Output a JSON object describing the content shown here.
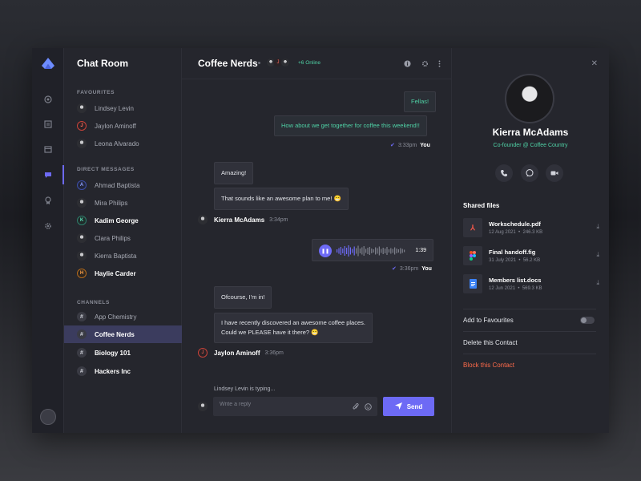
{
  "sidebar": {
    "title": "Chat Room",
    "sections": {
      "favourites": "FAVOURITES",
      "direct": "DIRECT MESSAGES",
      "channels": "CHANNELS"
    },
    "favourites": [
      {
        "name": "Lindsey Levin",
        "initial": ""
      },
      {
        "name": "Jaylon Aminoff",
        "initial": "J"
      },
      {
        "name": "Leona Alvarado",
        "initial": ""
      }
    ],
    "direct": [
      {
        "name": "Ahmad Baptista",
        "initial": "A"
      },
      {
        "name": "Mira Philips",
        "initial": ""
      },
      {
        "name": "Kadim George",
        "initial": "K"
      },
      {
        "name": "Clara Philips",
        "initial": ""
      },
      {
        "name": "Kierra Baptista",
        "initial": ""
      },
      {
        "name": "Haylie Carder",
        "initial": "H"
      }
    ],
    "channels": [
      {
        "name": "App Chemistry",
        "initial": "#"
      },
      {
        "name": "Coffee Nerds",
        "initial": "#"
      },
      {
        "name": "Biology 101",
        "initial": "#"
      },
      {
        "name": "Hackers Inc",
        "initial": "#"
      }
    ]
  },
  "chat": {
    "title": "Coffee Nerds",
    "online": "+6 Online",
    "header_initial": "J",
    "messages": {
      "m1": "Fellas!",
      "m2": "How about we get together for coffee this weekend!!",
      "m1_time": "3:33pm",
      "you": "You",
      "m3": "Amazing!",
      "m4": "That sounds like an awesome plan to me! 😁",
      "sender1": "Kierra McAdams",
      "sender1_time": "3:34pm",
      "voice_duration": "1:39",
      "voice_time": "3:36pm",
      "m5": "Ofcourse, I'm in!",
      "m6a": "I have recently discovered an awesome coffee places.",
      "m6b": "Could we PLEASE have it there? 😁",
      "sender2": "Jaylon Aminoff",
      "sender2_initial": "J",
      "sender2_time": "3:36pm"
    },
    "typing": "Lindsey Levin is typing...",
    "input_placeholder": "Write a reply",
    "send_label": "Send"
  },
  "profile": {
    "name": "Kierra McAdams",
    "role": "Co-founder @ Coffee Country",
    "shared_title": "Shared files",
    "files": [
      {
        "name": "Workschedule.pdf",
        "date": "12 Aug 2021",
        "size": "246.3 KB",
        "icon": "pdf-icon"
      },
      {
        "name": "Final handoff.fig",
        "date": "31 July 2021",
        "size": "56.2 KB",
        "icon": "figma-icon"
      },
      {
        "name": "Members list.docs",
        "date": "12 Jun 2021",
        "size": "569.3 KB",
        "icon": "docs-icon"
      }
    ],
    "actions": {
      "favourite": "Add to Favourites",
      "delete": "Delete this Contact",
      "block": "Block this Contact"
    }
  },
  "colors": {
    "accent": "#6d6af5",
    "success": "#4fd1a5",
    "danger": "#ff6b4a"
  }
}
